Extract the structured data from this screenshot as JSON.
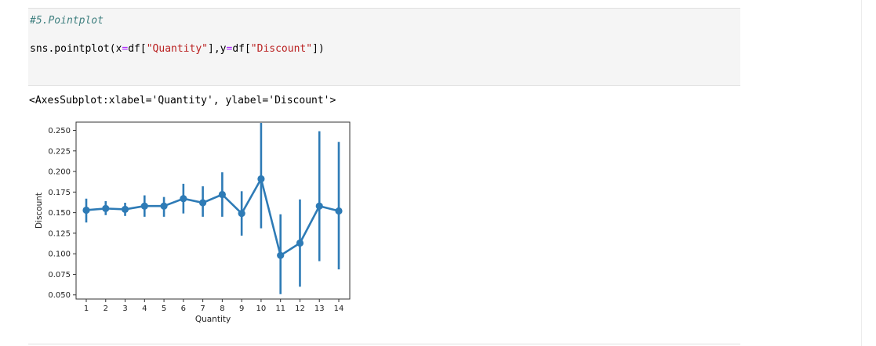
{
  "code_cell": {
    "comment": "#5.Pointplot",
    "call_prefix": "sns.pointplot(x",
    "eq1": "=",
    "df1": "df[",
    "str1": "\"Quantity\"",
    "mid": "],y",
    "eq2": "=",
    "df2": "df[",
    "str2": "\"Discount\"",
    "close": "])"
  },
  "output": {
    "repr": "<AxesSubplot:xlabel='Quantity', ylabel='Discount'>"
  },
  "colors": {
    "series": "#2e7bb6",
    "axis": "#333333"
  },
  "chart_data": {
    "type": "line",
    "title": "",
    "xlabel": "Quantity",
    "ylabel": "Discount",
    "x": [
      "1",
      "2",
      "3",
      "4",
      "5",
      "6",
      "7",
      "8",
      "9",
      "10",
      "11",
      "12",
      "13",
      "14"
    ],
    "ylim": [
      0.045,
      0.26
    ],
    "yticks": [
      "0.050",
      "0.075",
      "0.100",
      "0.125",
      "0.150",
      "0.175",
      "0.200",
      "0.225",
      "0.250"
    ],
    "series": [
      {
        "values": [
          0.153,
          0.155,
          0.154,
          0.158,
          0.158,
          0.167,
          0.162,
          0.172,
          0.149,
          0.191,
          0.098,
          0.113,
          0.158,
          0.152
        ],
        "ci_low": [
          0.138,
          0.147,
          0.146,
          0.145,
          0.145,
          0.149,
          0.145,
          0.145,
          0.122,
          0.131,
          0.051,
          0.06,
          0.091,
          0.081
        ],
        "ci_high": [
          0.167,
          0.164,
          0.162,
          0.171,
          0.169,
          0.185,
          0.182,
          0.199,
          0.176,
          0.259,
          0.148,
          0.166,
          0.249,
          0.236
        ]
      }
    ],
    "grid": false,
    "legend": "none"
  }
}
